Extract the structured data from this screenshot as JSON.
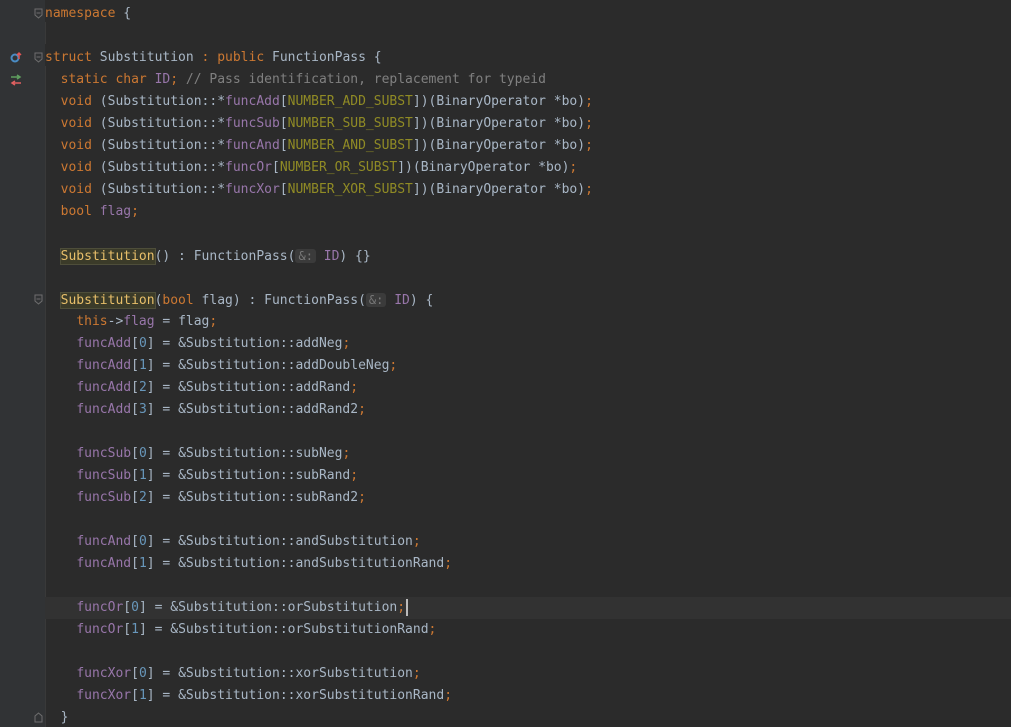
{
  "editor": {
    "language": "cpp",
    "colors": {
      "background": "#2b2b2b",
      "gutter": "#313335",
      "keyword": "#cc7832",
      "field": "#9876aa",
      "macro": "#908b25",
      "number": "#6897bb",
      "comment": "#808080",
      "text": "#a9b7c6",
      "highlight": "#e8bf6a"
    },
    "gutter_icons": [
      "override-marker-icon",
      "implementation-arrows-icon"
    ],
    "lines": [
      {
        "t": [
          [
            "namespace",
            "kw"
          ],
          [
            " {",
            ""
          ]
        ]
      },
      {
        "t": []
      },
      {
        "t": [
          [
            "struct",
            "kw"
          ],
          [
            " Substitution ",
            ""
          ],
          [
            ":",
            "kw"
          ],
          [
            " ",
            ""
          ],
          [
            "public",
            "kw"
          ],
          [
            " FunctionPass {",
            ""
          ]
        ]
      },
      {
        "t": [
          [
            "  ",
            ""
          ],
          [
            "static",
            "kw"
          ],
          [
            " ",
            ""
          ],
          [
            "char",
            "kw"
          ],
          [
            " ",
            ""
          ],
          [
            "ID",
            "fld"
          ],
          [
            ";",
            "kw"
          ],
          [
            " // Pass identification, replacement for typeid",
            "cmt"
          ]
        ]
      },
      {
        "t": [
          [
            "  ",
            ""
          ],
          [
            "void",
            "kw"
          ],
          [
            " (Substitution::*",
            ""
          ],
          [
            "funcAdd",
            "fld"
          ],
          [
            "[",
            ""
          ],
          [
            "NUMBER_ADD_SUBST",
            "mac"
          ],
          [
            "])(BinaryOperator *bo)",
            ""
          ],
          [
            ";",
            "kw"
          ]
        ]
      },
      {
        "t": [
          [
            "  ",
            ""
          ],
          [
            "void",
            "kw"
          ],
          [
            " (Substitution::*",
            ""
          ],
          [
            "funcSub",
            "fld"
          ],
          [
            "[",
            ""
          ],
          [
            "NUMBER_SUB_SUBST",
            "mac"
          ],
          [
            "])(BinaryOperator *bo)",
            ""
          ],
          [
            ";",
            "kw"
          ]
        ]
      },
      {
        "t": [
          [
            "  ",
            ""
          ],
          [
            "void",
            "kw"
          ],
          [
            " (Substitution::*",
            ""
          ],
          [
            "funcAnd",
            "fld"
          ],
          [
            "[",
            ""
          ],
          [
            "NUMBER_AND_SUBST",
            "mac"
          ],
          [
            "])(BinaryOperator *bo)",
            ""
          ],
          [
            ";",
            "kw"
          ]
        ]
      },
      {
        "t": [
          [
            "  ",
            ""
          ],
          [
            "void",
            "kw"
          ],
          [
            " (Substitution::*",
            ""
          ],
          [
            "funcOr",
            "fld"
          ],
          [
            "[",
            ""
          ],
          [
            "NUMBER_OR_SUBST",
            "mac"
          ],
          [
            "])(BinaryOperator *bo)",
            ""
          ],
          [
            ";",
            "kw"
          ]
        ]
      },
      {
        "t": [
          [
            "  ",
            ""
          ],
          [
            "void",
            "kw"
          ],
          [
            " (Substitution::*",
            ""
          ],
          [
            "funcXor",
            "fld"
          ],
          [
            "[",
            ""
          ],
          [
            "NUMBER_XOR_SUBST",
            "mac"
          ],
          [
            "])(BinaryOperator *bo)",
            ""
          ],
          [
            ";",
            "kw"
          ]
        ]
      },
      {
        "t": [
          [
            "  ",
            ""
          ],
          [
            "bool",
            "kw"
          ],
          [
            " ",
            ""
          ],
          [
            "flag",
            "fld"
          ],
          [
            ";",
            "kw"
          ]
        ]
      },
      {
        "t": []
      },
      {
        "t": [
          [
            "  ",
            ""
          ],
          [
            "Substitution",
            "hl"
          ],
          [
            "() : FunctionPass(",
            ""
          ],
          [
            "&:",
            "hint"
          ],
          [
            " ",
            ""
          ],
          [
            "ID",
            "fld"
          ],
          [
            ") {}",
            ""
          ]
        ]
      },
      {
        "t": []
      },
      {
        "t": [
          [
            "  ",
            ""
          ],
          [
            "Substitution",
            "hl"
          ],
          [
            "(",
            ""
          ],
          [
            "bool",
            "kw"
          ],
          [
            " flag) : FunctionPass(",
            ""
          ],
          [
            "&:",
            "hint"
          ],
          [
            " ",
            ""
          ],
          [
            "ID",
            "fld"
          ],
          [
            ") {",
            ""
          ]
        ]
      },
      {
        "t": [
          [
            "    ",
            ""
          ],
          [
            "this",
            "kw"
          ],
          [
            "->",
            ""
          ],
          [
            "flag",
            "fld"
          ],
          [
            " = flag",
            ""
          ],
          [
            ";",
            "kw"
          ]
        ]
      },
      {
        "t": [
          [
            "    ",
            ""
          ],
          [
            "funcAdd",
            "fld"
          ],
          [
            "[",
            ""
          ],
          [
            "0",
            "num"
          ],
          [
            "] = &Substitution::addNeg",
            ""
          ],
          [
            ";",
            "kw"
          ]
        ]
      },
      {
        "t": [
          [
            "    ",
            ""
          ],
          [
            "funcAdd",
            "fld"
          ],
          [
            "[",
            ""
          ],
          [
            "1",
            "num"
          ],
          [
            "] = &Substitution::addDoubleNeg",
            ""
          ],
          [
            ";",
            "kw"
          ]
        ]
      },
      {
        "t": [
          [
            "    ",
            ""
          ],
          [
            "funcAdd",
            "fld"
          ],
          [
            "[",
            ""
          ],
          [
            "2",
            "num"
          ],
          [
            "] = &Substitution::addRand",
            ""
          ],
          [
            ";",
            "kw"
          ]
        ]
      },
      {
        "t": [
          [
            "    ",
            ""
          ],
          [
            "funcAdd",
            "fld"
          ],
          [
            "[",
            ""
          ],
          [
            "3",
            "num"
          ],
          [
            "] = &Substitution::addRand2",
            ""
          ],
          [
            ";",
            "kw"
          ]
        ]
      },
      {
        "t": []
      },
      {
        "t": [
          [
            "    ",
            ""
          ],
          [
            "funcSub",
            "fld"
          ],
          [
            "[",
            ""
          ],
          [
            "0",
            "num"
          ],
          [
            "] = &Substitution::subNeg",
            ""
          ],
          [
            ";",
            "kw"
          ]
        ]
      },
      {
        "t": [
          [
            "    ",
            ""
          ],
          [
            "funcSub",
            "fld"
          ],
          [
            "[",
            ""
          ],
          [
            "1",
            "num"
          ],
          [
            "] = &Substitution::subRand",
            ""
          ],
          [
            ";",
            "kw"
          ]
        ]
      },
      {
        "t": [
          [
            "    ",
            ""
          ],
          [
            "funcSub",
            "fld"
          ],
          [
            "[",
            ""
          ],
          [
            "2",
            "num"
          ],
          [
            "] = &Substitution::subRand2",
            ""
          ],
          [
            ";",
            "kw"
          ]
        ]
      },
      {
        "t": []
      },
      {
        "t": [
          [
            "    ",
            ""
          ],
          [
            "funcAnd",
            "fld"
          ],
          [
            "[",
            ""
          ],
          [
            "0",
            "num"
          ],
          [
            "] = &Substitution::andSubstitution",
            ""
          ],
          [
            ";",
            "kw"
          ]
        ]
      },
      {
        "t": [
          [
            "    ",
            ""
          ],
          [
            "funcAnd",
            "fld"
          ],
          [
            "[",
            ""
          ],
          [
            "1",
            "num"
          ],
          [
            "] = &Substitution::andSubstitutionRand",
            ""
          ],
          [
            ";",
            "kw"
          ]
        ]
      },
      {
        "t": []
      },
      {
        "t": [
          [
            "    ",
            ""
          ],
          [
            "funcOr",
            "fld"
          ],
          [
            "[",
            ""
          ],
          [
            "0",
            "num"
          ],
          [
            "] = &Substitution::orSubstitution",
            ""
          ],
          [
            ";",
            "kw"
          ]
        ],
        "current": true,
        "caret": true
      },
      {
        "t": [
          [
            "    ",
            ""
          ],
          [
            "funcOr",
            "fld"
          ],
          [
            "[",
            ""
          ],
          [
            "1",
            "num"
          ],
          [
            "] = &Substitution::orSubstitutionRand",
            ""
          ],
          [
            ";",
            "kw"
          ]
        ]
      },
      {
        "t": []
      },
      {
        "t": [
          [
            "    ",
            ""
          ],
          [
            "funcXor",
            "fld"
          ],
          [
            "[",
            ""
          ],
          [
            "0",
            "num"
          ],
          [
            "] = &Substitution::xorSubstitution",
            ""
          ],
          [
            ";",
            "kw"
          ]
        ]
      },
      {
        "t": [
          [
            "    ",
            ""
          ],
          [
            "funcXor",
            "fld"
          ],
          [
            "[",
            ""
          ],
          [
            "1",
            "num"
          ],
          [
            "] = &Substitution::xorSubstitutionRand",
            ""
          ],
          [
            ";",
            "kw"
          ]
        ]
      },
      {
        "t": [
          [
            "  }",
            ""
          ]
        ]
      }
    ],
    "folds": [
      0,
      2,
      13,
      32
    ]
  }
}
